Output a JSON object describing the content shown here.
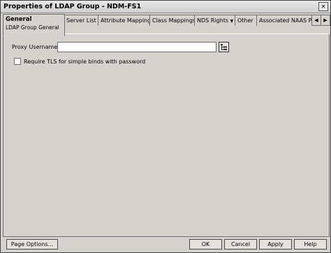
{
  "window": {
    "title": "Properties of LDAP Group - NDM-FS1",
    "close_glyph": "✕"
  },
  "tabs": {
    "active": {
      "label": "General",
      "sub_label": "LDAP Group General"
    },
    "items": [
      {
        "label": "Server List"
      },
      {
        "label": "Attribute Mappings"
      },
      {
        "label": "Class Mappings"
      },
      {
        "label": "NDS Rights"
      },
      {
        "label": "Other"
      },
      {
        "label": "Associated NAAS P("
      }
    ],
    "scroll_left": "◀",
    "scroll_right": "▶"
  },
  "form": {
    "proxy_username_label": "Proxy Username:",
    "proxy_username_value": "",
    "require_tls_label": "Require TLS for simple binds with password",
    "require_tls_checked": false
  },
  "buttons": {
    "page_options": "Page Options...",
    "ok": "OK",
    "cancel": "Cancel",
    "apply": "Apply",
    "help": "Help"
  }
}
